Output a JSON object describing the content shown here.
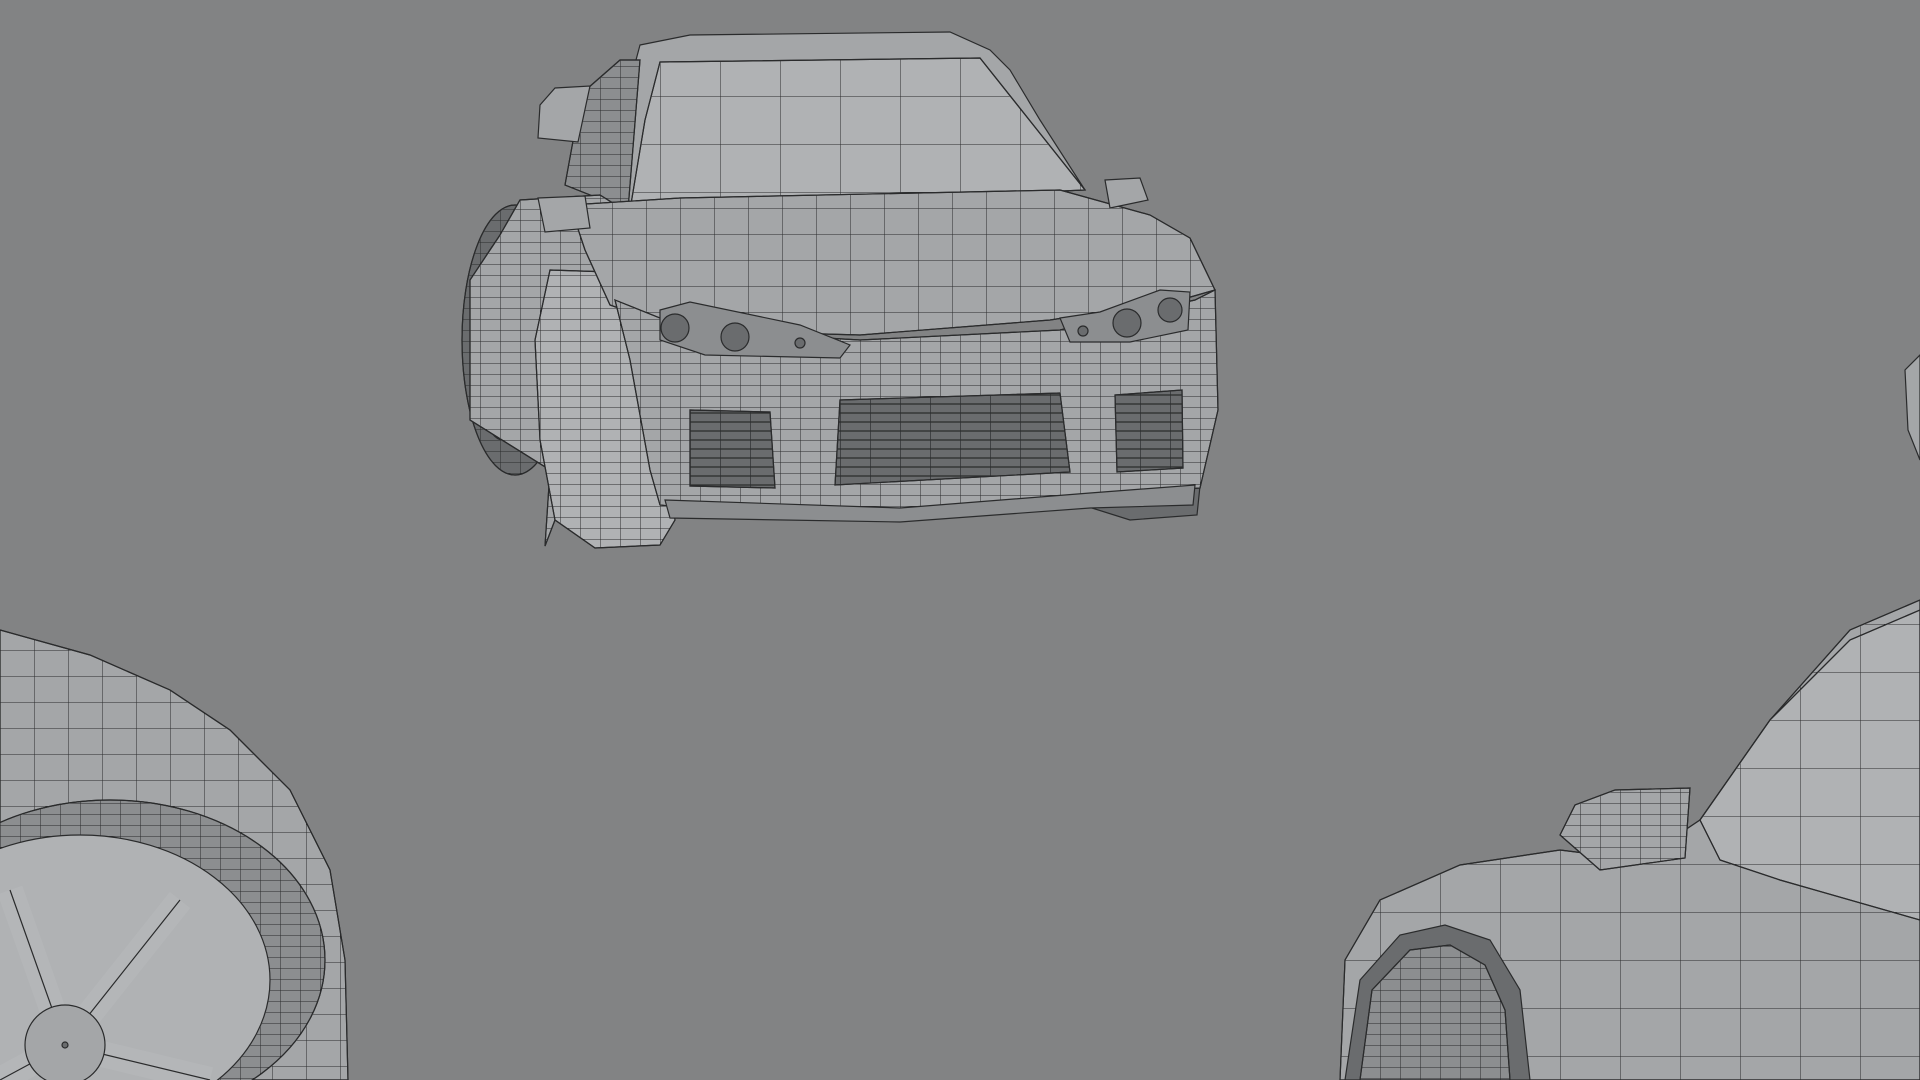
{
  "scene": {
    "background_color": "#828384",
    "model_fill_color": "#a4a6a8",
    "model_shade_color": "#8c8e90",
    "model_dark_color": "#6a6c6e",
    "wire_color": "#2a2b2c",
    "models": [
      {
        "name": "car-front-view"
      },
      {
        "name": "car-wheel-closeup-left"
      },
      {
        "name": "car-fender-closeup-right"
      }
    ]
  }
}
